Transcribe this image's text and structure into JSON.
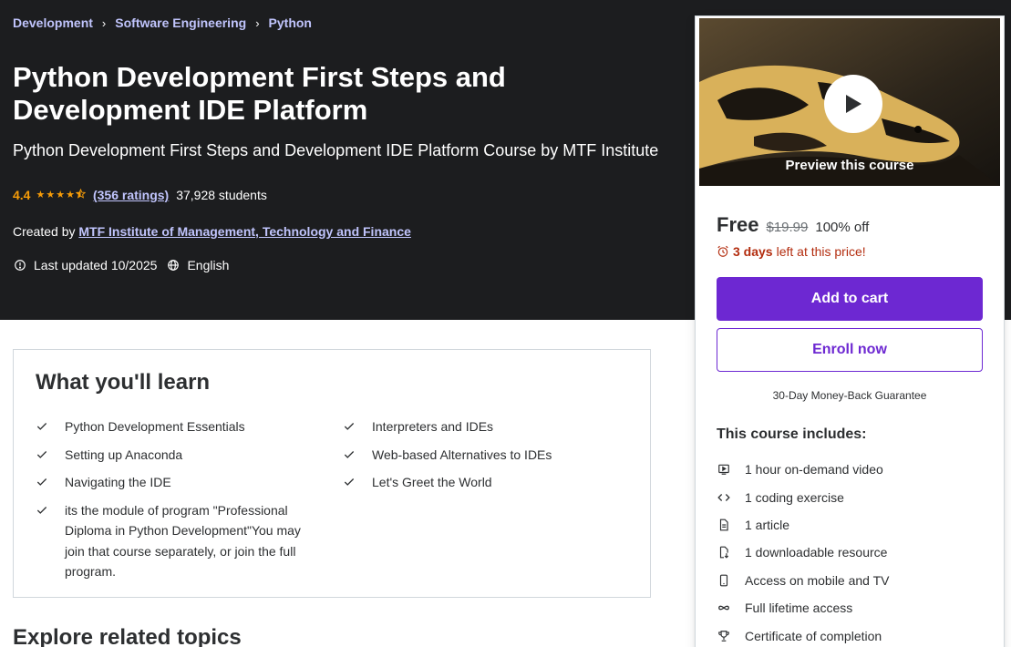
{
  "breadcrumb": {
    "items": [
      "Development",
      "Software Engineering",
      "Python"
    ],
    "separator": "›"
  },
  "course": {
    "title": "Python Development First Steps and Development IDE Platform",
    "subtitle": "Python Development First Steps and Development IDE Platform Course by MTF Institute",
    "rating": "4.4",
    "stars_value": 4.4,
    "ratings_count": "(356 ratings)",
    "students": "37,928 students",
    "created_by_label": "Created by",
    "creator": "MTF Institute of Management, Technology and Finance",
    "last_updated": "Last updated 10/2025",
    "language": "English"
  },
  "sidebar": {
    "preview_label": "Preview this course",
    "price_now": "Free",
    "price_old": "$19.99",
    "discount": "100% off",
    "deadline_bold": "3 days",
    "deadline_rest": "left at this price!",
    "add_to_cart": "Add to cart",
    "enroll_now": "Enroll now",
    "guarantee": "30-Day Money-Back Guarantee",
    "includes_title": "This course includes:",
    "includes": [
      {
        "icon": "video-icon",
        "label": "1 hour on-demand video"
      },
      {
        "icon": "code-icon",
        "label": "1 coding exercise"
      },
      {
        "icon": "article-icon",
        "label": "1 article"
      },
      {
        "icon": "download-icon",
        "label": "1 downloadable resource"
      },
      {
        "icon": "mobile-icon",
        "label": "Access on mobile and TV"
      },
      {
        "icon": "infinity-icon",
        "label": "Full lifetime access"
      },
      {
        "icon": "trophy-icon",
        "label": "Certificate of completion"
      }
    ]
  },
  "learn": {
    "title": "What you'll learn",
    "left": [
      "Python Development Essentials",
      "Setting up Anaconda",
      "Navigating the IDE",
      "its the module of program \"Professional Diploma in Python Development\"You may join that course separately, or join the full program."
    ],
    "right": [
      "Interpreters and IDEs",
      "Web-based Alternatives to IDEs",
      "Let's Greet the World"
    ]
  },
  "explore": {
    "title": "Explore related topics"
  },
  "colors": {
    "hero_bg": "#1c1d1f",
    "link_purple": "#c0c4fc",
    "star_orange": "#f69c08",
    "brand_purple": "#6d28d2",
    "deadline_red": "#b32d0f"
  }
}
